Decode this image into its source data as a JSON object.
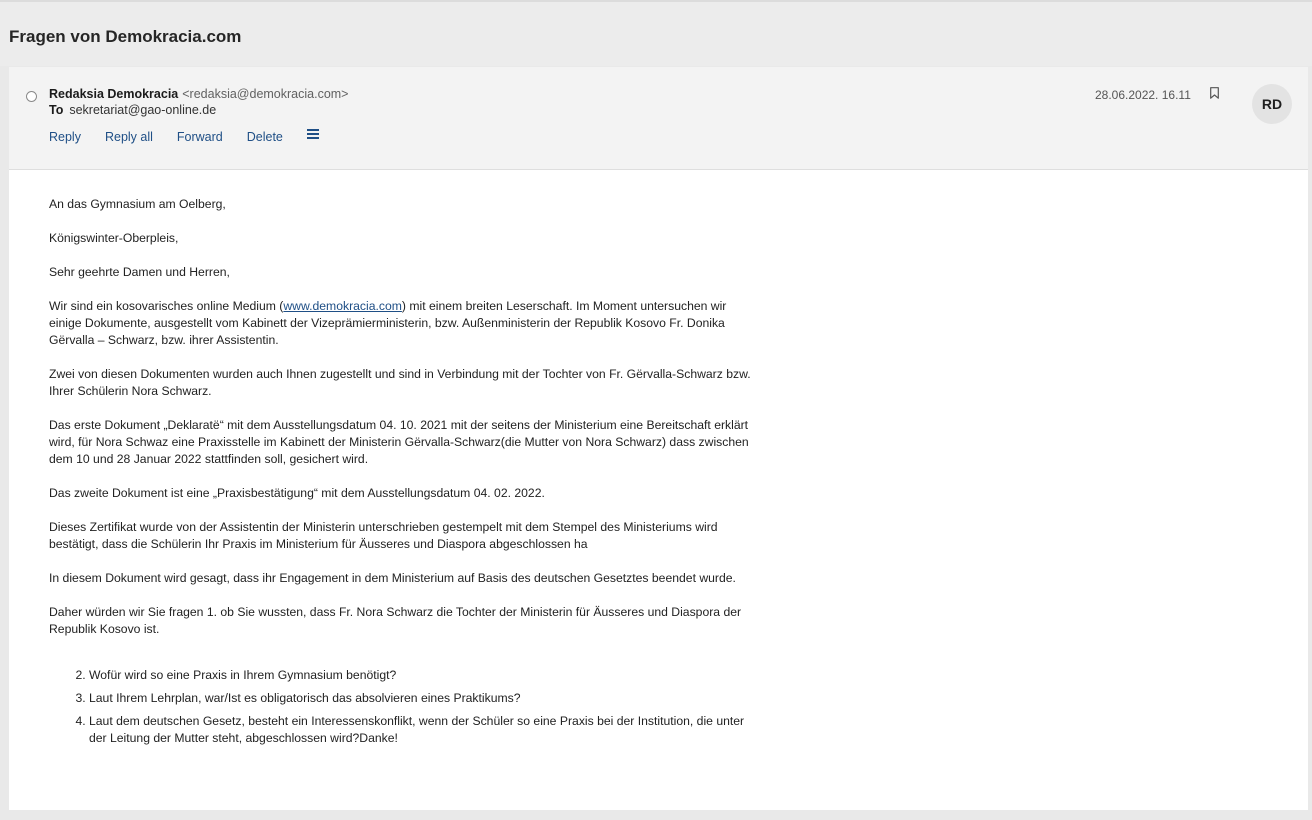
{
  "email": {
    "subject": "Fragen von Demokracia.com",
    "from_name": "Redaksia Demokracia",
    "from_email": "<redaksia@demokracia.com>",
    "to_label": "To",
    "to_address": "sekretariat@gao-online.de",
    "date": "28.06.2022. 16.11",
    "avatar_initials": "RD",
    "actions": {
      "reply": "Reply",
      "reply_all": "Reply all",
      "forward": "Forward",
      "delete": "Delete"
    },
    "icons": [
      "radio-select-icon",
      "flag-bookmark-icon",
      "more-menu-icon"
    ]
  },
  "body": {
    "p1": "An das Gymnasium am Oelberg,",
    "p2": "Königswinter-Oberpleis,",
    "p3": "Sehr geehrte Damen und Herren,",
    "p4_before": "Wir sind ein kosovarisches online Medium (",
    "p4_link": "www.demokracia.com",
    "p4_after": ") mit einem breiten Leserschaft. Im Moment untersuchen wir einige Dokumente, ausgestellt vom Kabinett der Vizeprämierministerin, bzw. Außenministerin der Republik Kosovo Fr. Donika Gërvalla – Schwarz, bzw. ihrer Assistentin.",
    "p5": "Zwei von diesen Dokumenten wurden auch Ihnen zugestellt und sind in Verbindung mit der Tochter von Fr. Gërvalla-Schwarz bzw. Ihrer Schülerin Nora Schwarz.",
    "p6": "Das erste Dokument „Deklaratë“ mit dem Ausstellungsdatum 04. 10. 2021 mit der seitens der Ministerium eine Bereitschaft erklärt wird, für Nora Schwaz eine Praxisstelle im Kabinett der Ministerin Gërvalla-Schwarz(die Mutter von Nora Schwarz) dass zwischen dem 10 und 28 Januar 2022 stattfinden soll, gesichert wird.",
    "p7": "Das zweite Dokument ist eine „Praxisbestätigung“ mit dem Ausstellungsdatum 04. 02. 2022.",
    "p8": "Dieses Zertifikat wurde von der Assistentin der Ministerin unterschrieben gestempelt mit dem Stempel des Ministeriums wird bestätigt, dass die Schülerin Ihr Praxis im Ministerium für Äusseres und Diaspora abgeschlossen ha",
    "p9": "In diesem Dokument wird gesagt, dass ihr Engagement in dem Ministerium auf Basis des deutschen Gesetztes beendet wurde.",
    "p10": "Daher würden wir Sie fragen 1. ob Sie wussten, dass Fr. Nora Schwarz die Tochter der Ministerin für Äusseres und Diaspora der Republik Kosovo ist.",
    "q2": "Wofür wird so eine Praxis in Ihrem Gymnasium benötigt?",
    "q3": "Laut Ihrem Lehrplan, war/Ist es obligatorisch das absolvieren eines Praktikums?",
    "q4": "Laut dem deutschen Gesetz, besteht ein Interessenskonflikt, wenn der Schüler so eine Praxis bei der Institution, die unter der Leitung der Mutter steht, abgeschlossen wird?Danke!"
  }
}
